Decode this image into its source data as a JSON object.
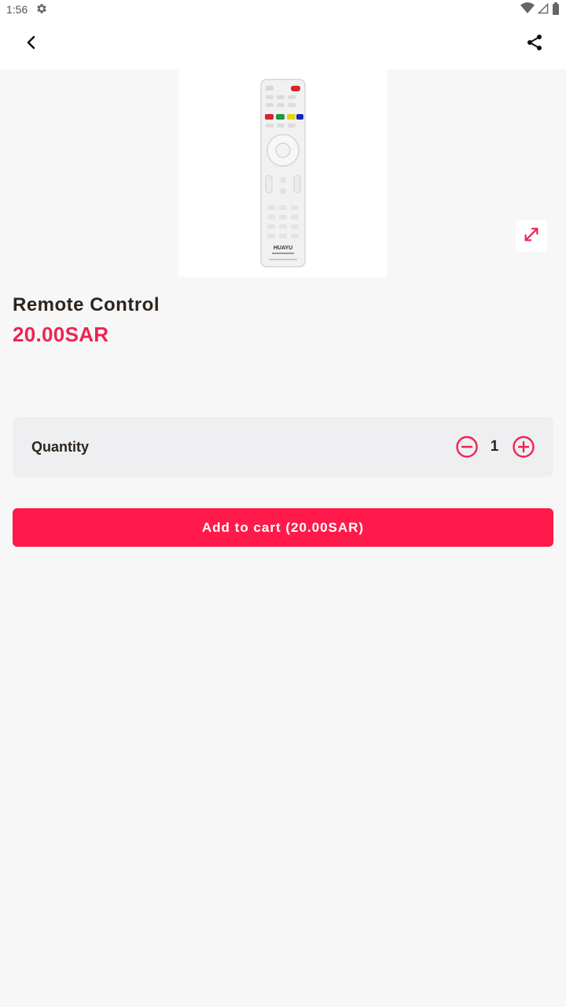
{
  "status_bar": {
    "time": "1:56",
    "icons": [
      "settings-icon",
      "wifi-icon",
      "signal-icon",
      "battery-icon"
    ]
  },
  "app_bar": {
    "back_icon": "back-chevron-icon",
    "share_icon": "share-icon"
  },
  "product": {
    "image_alt": "HUAYU",
    "expand_icon": "expand-icon",
    "title": "Remote Control",
    "price": "20.00SAR"
  },
  "quantity": {
    "label": "Quantity",
    "value": "1",
    "minus_icon": "minus-circle-icon",
    "plus_icon": "plus-circle-icon"
  },
  "cart": {
    "button_label": "Add to cart (20.00SAR)"
  },
  "colors": {
    "accent": "#ee2451",
    "button": "#ff1a4b",
    "background": "#f7f7f8",
    "card": "#efeff2"
  }
}
